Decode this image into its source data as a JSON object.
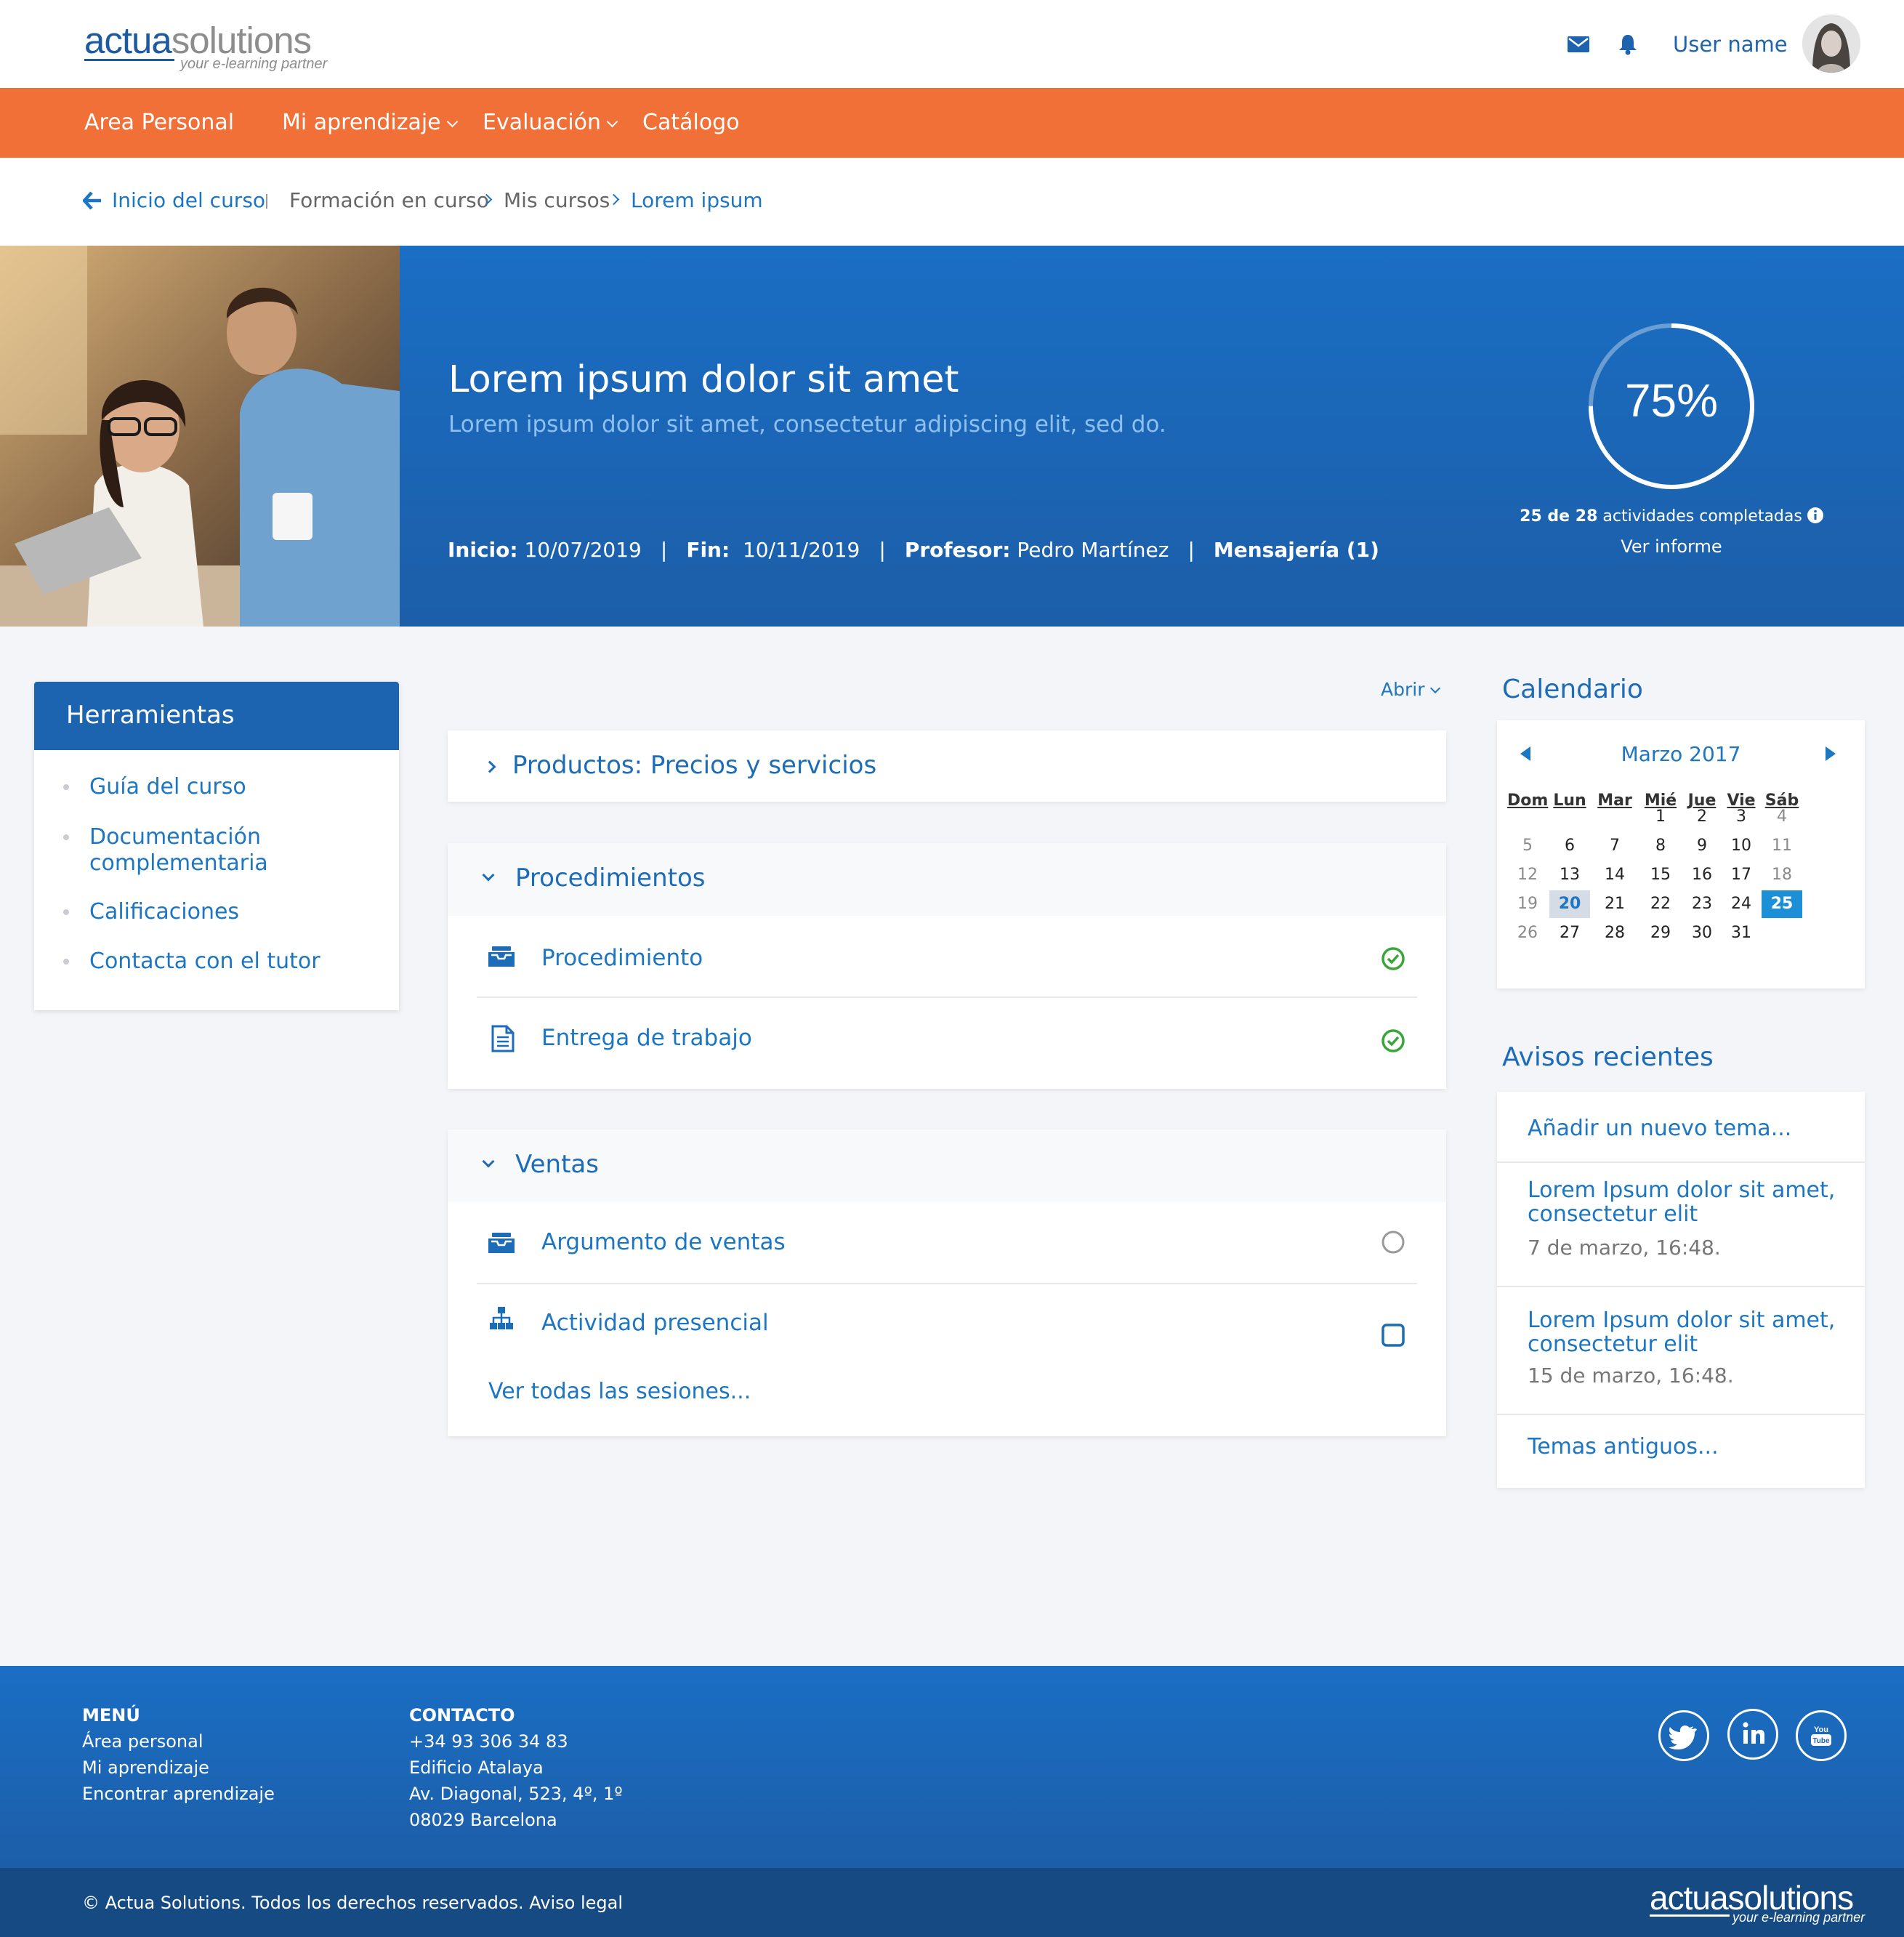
{
  "header": {
    "logo": {
      "main_a": "actua",
      "main_b": "solutions",
      "tagline": "your e-learning partner"
    },
    "username": "User name"
  },
  "nav": {
    "items": [
      {
        "label": "Area Personal",
        "dropdown": false
      },
      {
        "label": "Mi aprendizaje",
        "dropdown": true
      },
      {
        "label": "Evaluación",
        "dropdown": true
      },
      {
        "label": "Catálogo",
        "dropdown": false
      }
    ]
  },
  "breadcrumb": {
    "back": "Inicio del curso",
    "items": [
      "Formación en curso",
      "Mis cursos",
      "Lorem ipsum"
    ]
  },
  "course": {
    "title": "Lorem ipsum dolor sit amet",
    "subtitle": "Lorem ipsum dolor sit amet, consectetur adipiscing elit, sed do.",
    "start_label": "Inicio:",
    "start": "10/07/2019",
    "end_label": "Fin:",
    "end": "10/11/2019",
    "teacher_label": "Profesor:",
    "teacher": "Pedro Martínez",
    "messaging": "Mensajería (1)",
    "progress": {
      "percent": 75,
      "percent_label": "75%",
      "done_count": "25 de 28",
      "done_text": "actividades completadas",
      "report": "Ver informe"
    }
  },
  "tools": {
    "title": "Herramientas",
    "items": [
      "Guía del curso",
      "Documentación complementaria",
      "Calificaciones",
      "Contacta con el tutor"
    ]
  },
  "modules": {
    "toggle": "Abrir",
    "sections": [
      {
        "title": "Productos: Precios y servicios",
        "expanded": false
      },
      {
        "title": "Procedimientos",
        "expanded": true,
        "rows": [
          {
            "label": "Procedimiento",
            "icon": "inbox-icon",
            "status": "completed"
          },
          {
            "label": "Entrega de trabajo",
            "icon": "document-icon",
            "status": "completed"
          }
        ]
      },
      {
        "title": "Ventas",
        "expanded": true,
        "rows": [
          {
            "label": "Argumento de ventas",
            "icon": "inbox-icon",
            "status": "pending"
          },
          {
            "label": "Actividad presencial",
            "icon": "sitemap-icon",
            "status": "not-started"
          }
        ],
        "more": "Ver todas las sesiones..."
      }
    ]
  },
  "calendar": {
    "title": "Calendario",
    "month": "Marzo 2017",
    "weekdays": [
      "Dom",
      "Lun",
      "Mar",
      "Mié",
      "Jue",
      "Vie",
      "Sáb"
    ],
    "weeks": [
      [
        "",
        "",
        "",
        "1",
        "2",
        "3",
        "4"
      ],
      [
        "5",
        "6",
        "7",
        "8",
        "9",
        "10",
        "11"
      ],
      [
        "12",
        "13",
        "14",
        "15",
        "16",
        "17",
        "18"
      ],
      [
        "19",
        "20",
        "21",
        "22",
        "23",
        "24",
        "25"
      ],
      [
        "26",
        "27",
        "28",
        "29",
        "30",
        "31",
        ""
      ]
    ],
    "selected_day": "20",
    "today": "25"
  },
  "notices": {
    "title": "Avisos recientes",
    "add": "Añadir un nuevo tema...",
    "items": [
      {
        "title": "Lorem Ipsum dolor sit amet, consectetur elit",
        "date": "7 de marzo, 16:48."
      },
      {
        "title": "Lorem Ipsum dolor sit amet, consectetur elit",
        "date": "15 de marzo, 16:48."
      }
    ],
    "old": "Temas antiguos..."
  },
  "footer": {
    "menu_title": "MENÚ",
    "menu": [
      "Área personal",
      "Mi aprendizaje",
      "Encontrar aprendizaje"
    ],
    "contact_title": "CONTACTO",
    "contact": [
      "+34 93 306 34 83",
      "Edificio Atalaya",
      "Av. Diagonal, 523, 4º, 1º",
      "08029 Barcelona"
    ],
    "social": [
      "twitter-icon",
      "linkedin-icon",
      "youtube-icon"
    ],
    "youtube_text": "You Tube",
    "copyright": "© Actua Solutions. Todos los derechos reservados. Aviso legal"
  },
  "colors": {
    "accent_orange": "#f07038",
    "brand_blue": "#1d64b0",
    "link_blue": "#1d76c2",
    "success_green": "#3aa63a"
  }
}
